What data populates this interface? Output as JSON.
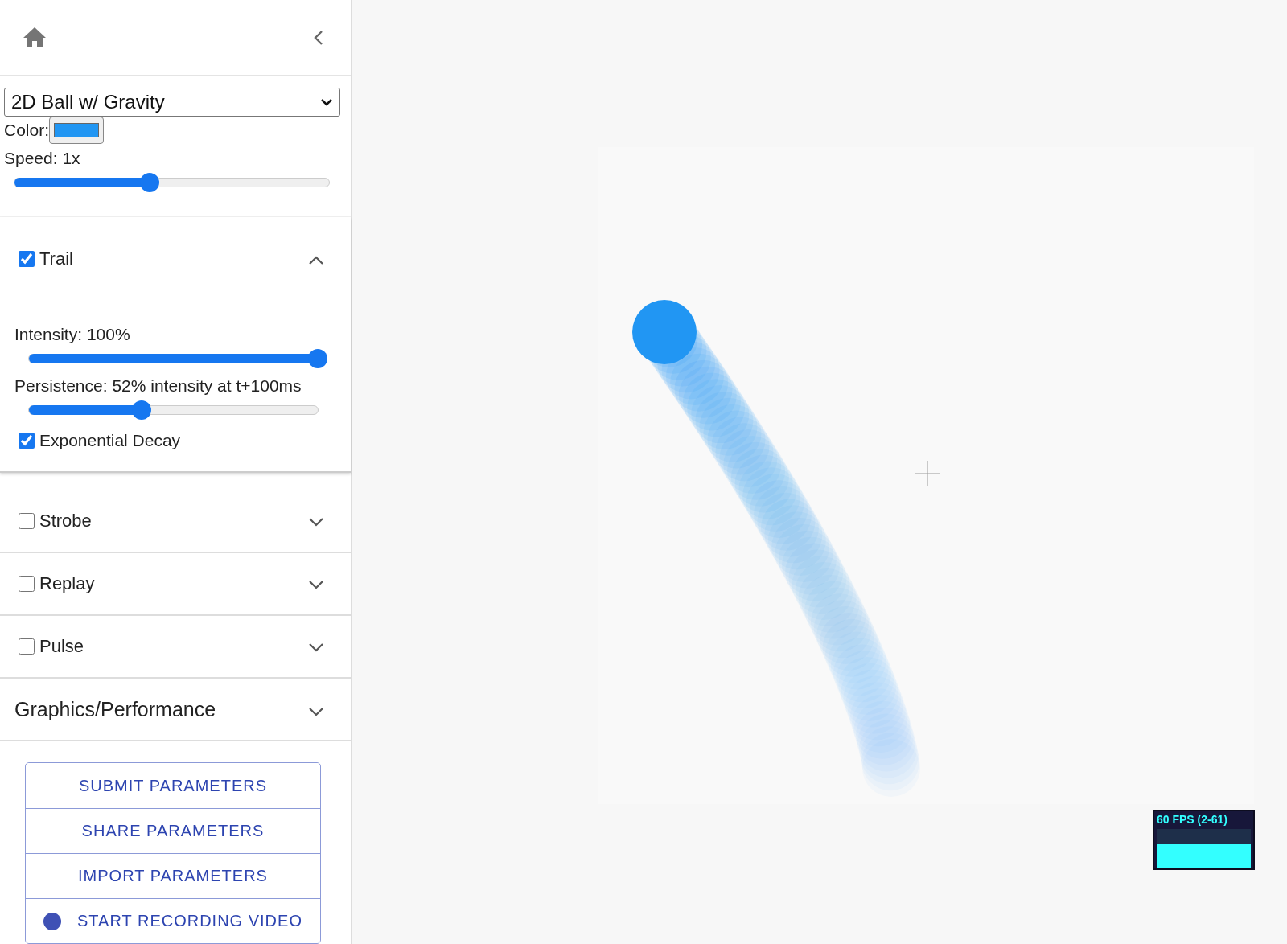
{
  "sidebar": {
    "simulation_select": {
      "value": "2D Ball w/ Gravity"
    },
    "color_picker": {
      "label": "Color:",
      "color": "#2196f3"
    },
    "speed": {
      "label": "Speed: 1x",
      "level": 0.43
    },
    "sections": [
      {
        "kind": "checkbox",
        "label": "Trail",
        "checked": true,
        "expanded": true,
        "controls": [
          {
            "kind": "slider",
            "label": "Intensity: 100%",
            "level": 1
          },
          {
            "kind": "slider",
            "label": "Persistence: 52% intensity at t+100ms",
            "level": 0.39
          },
          {
            "kind": "checkbox",
            "label": "Exponential Decay",
            "checked": true
          }
        ]
      },
      {
        "kind": "checkbox",
        "label": "Strobe",
        "checked": false,
        "expanded": false
      },
      {
        "kind": "checkbox",
        "label": "Replay",
        "checked": false,
        "expanded": false
      },
      {
        "kind": "checkbox",
        "label": "Pulse",
        "checked": false,
        "expanded": false
      },
      {
        "kind": "plain",
        "label": "Graphics/Performance",
        "expanded": false
      }
    ],
    "buttons": [
      {
        "kind": "plain",
        "label": "SUBMIT PARAMETERS"
      },
      {
        "kind": "plain",
        "label": "SHARE PARAMETERS"
      },
      {
        "kind": "plain",
        "label": "IMPORT PARAMETERS"
      },
      {
        "kind": "record",
        "label": "START RECORDING VIDEO"
      }
    ]
  },
  "fps_meter": {
    "label": "60 FPS (2-61)"
  }
}
